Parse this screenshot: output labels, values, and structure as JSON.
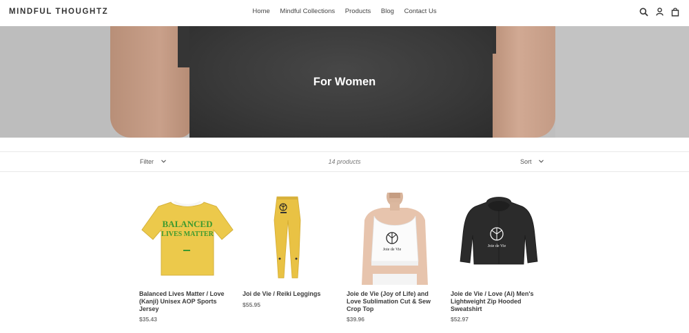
{
  "store": {
    "name": "MINDFUL THOUGHTZ"
  },
  "nav": {
    "items": [
      "Home",
      "Mindful Collections",
      "Products",
      "Blog",
      "Contact Us"
    ]
  },
  "hero": {
    "title": "For Women"
  },
  "toolbar": {
    "filter_label": "Filter",
    "count": "14 products",
    "sort_label": "Sort"
  },
  "products": [
    {
      "title": "Balanced Lives Matter / Love (Kanji) Unisex AOP Sports Jersey",
      "price": "$35.43",
      "print_line1": "BALANCED",
      "print_line2": "LIVES MATTER"
    },
    {
      "title": "Joi de Vie / Reiki Leggings",
      "price": "$55.95"
    },
    {
      "title": "Joie de Vie (Joy of Life) and Love Sublimation Cut & Sew Crop Top",
      "price": "$39.96",
      "print_text": "Joie de Vie"
    },
    {
      "title": "Joie de Vie / Love (Ai) Men's Lightweight Zip Hooded Sweatshirt",
      "price": "$52.97",
      "print_text": "Joie de Vie"
    }
  ],
  "colors": {
    "jersey_yellow": "#ecc94b",
    "jersey_text": "#3c9a2f",
    "leggings": "#e9c244",
    "hoodie": "#2b2b2b"
  }
}
